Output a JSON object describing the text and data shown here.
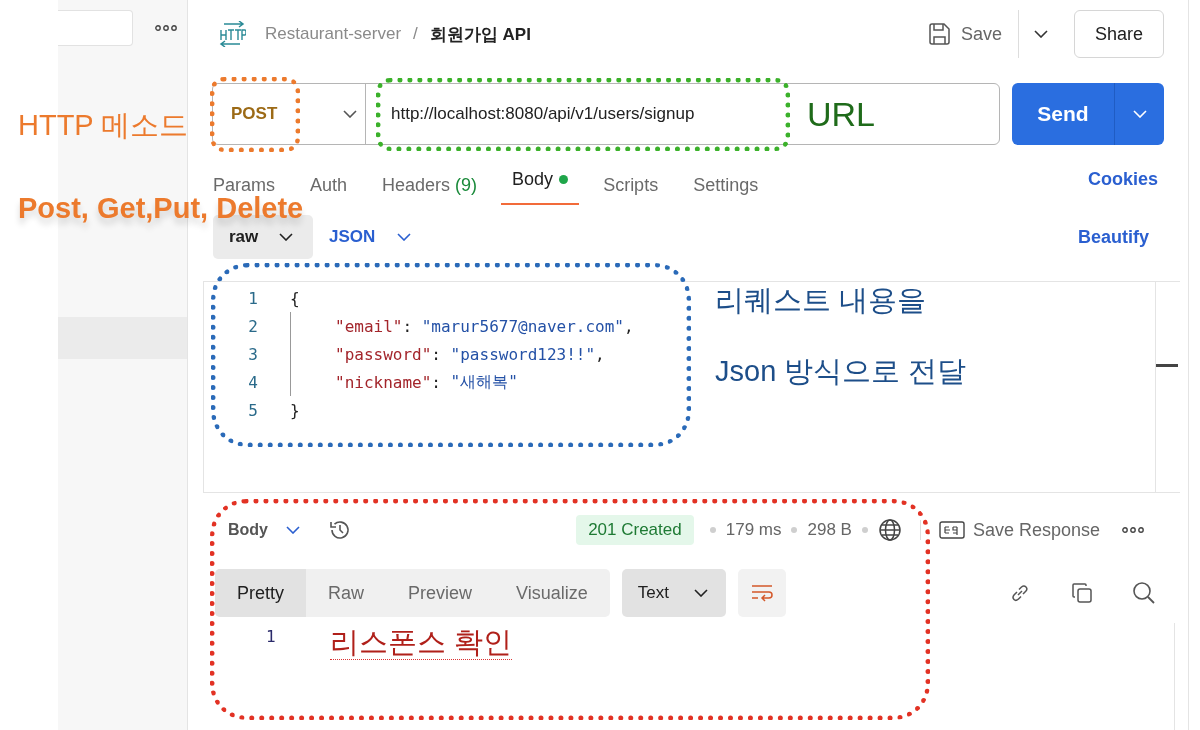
{
  "breadcrumb": {
    "collection": "Restaurant-server",
    "separator": "/",
    "request": "회원가입 API"
  },
  "header_actions": {
    "save": "Save",
    "share": "Share"
  },
  "request": {
    "method": "POST",
    "url": "http://localhost:8080/api/v1/users/signup",
    "send": "Send"
  },
  "tabs": [
    {
      "label": "Params",
      "selected": false
    },
    {
      "label": "Auth",
      "selected": false
    },
    {
      "label": "Headers",
      "count": "(9)",
      "selected": false
    },
    {
      "label": "Body",
      "selected": true,
      "modified": true
    },
    {
      "label": "Scripts",
      "selected": false
    },
    {
      "label": "Settings",
      "selected": false
    }
  ],
  "cookies": "Cookies",
  "body_options": {
    "mode": "raw",
    "language": "JSON",
    "beautify": "Beautify"
  },
  "request_body": [
    {
      "number": "1",
      "indented": false,
      "tokens": [
        {
          "kind": "punct",
          "text": "{"
        }
      ]
    },
    {
      "number": "2",
      "indented": true,
      "tokens": [
        {
          "kind": "key",
          "text": "\"email\""
        },
        {
          "kind": "punct",
          "text": ": "
        },
        {
          "kind": "string",
          "text": "\"marur5677@naver.com\""
        },
        {
          "kind": "punct",
          "text": ","
        }
      ]
    },
    {
      "number": "3",
      "indented": true,
      "tokens": [
        {
          "kind": "key",
          "text": "\"password\""
        },
        {
          "kind": "punct",
          "text": ": "
        },
        {
          "kind": "string",
          "text": "\"password123!!\""
        },
        {
          "kind": "punct",
          "text": ","
        }
      ]
    },
    {
      "number": "4",
      "indented": true,
      "tokens": [
        {
          "kind": "key",
          "text": "\"nickname\""
        },
        {
          "kind": "punct",
          "text": ": "
        },
        {
          "kind": "string",
          "text": "\"새해복\""
        }
      ]
    },
    {
      "number": "5",
      "indented": false,
      "tokens": [
        {
          "kind": "punct",
          "text": "}"
        }
      ]
    }
  ],
  "response": {
    "view": "Body",
    "status": "201 Created",
    "time": "179 ms",
    "size": "298 B",
    "save_response": "Save Response",
    "view_tabs": [
      {
        "label": "Pretty",
        "selected": true
      },
      {
        "label": "Raw",
        "selected": false
      },
      {
        "label": "Preview",
        "selected": false
      },
      {
        "label": "Visualize",
        "selected": false
      }
    ],
    "format": "Text",
    "line_numbers": [
      "1"
    ]
  },
  "annotation_frames": [
    {
      "color": "#ec7a2d"
    },
    {
      "color": "#3bb12a"
    },
    {
      "color": "#2a6ab8"
    },
    {
      "color": "#e23224"
    }
  ],
  "annotation_notes": [
    {
      "text": "HTTP 메소드",
      "color": "#ec7a2d",
      "bold": false
    },
    {
      "text": "Post, Get,Put, Delete",
      "color": "#ec7a2d",
      "bold": true
    },
    {
      "text": "URL",
      "color": "#1f6b1a",
      "bold": false
    },
    {
      "text": "리퀘스트 내용을",
      "color": "#1d4e89",
      "bold": false
    },
    {
      "text": "Json 방식으로 전달",
      "color": "#1d4e89",
      "bold": false
    },
    {
      "text": "리스폰스 확인",
      "color": "#b0201a",
      "bold": false
    }
  ]
}
